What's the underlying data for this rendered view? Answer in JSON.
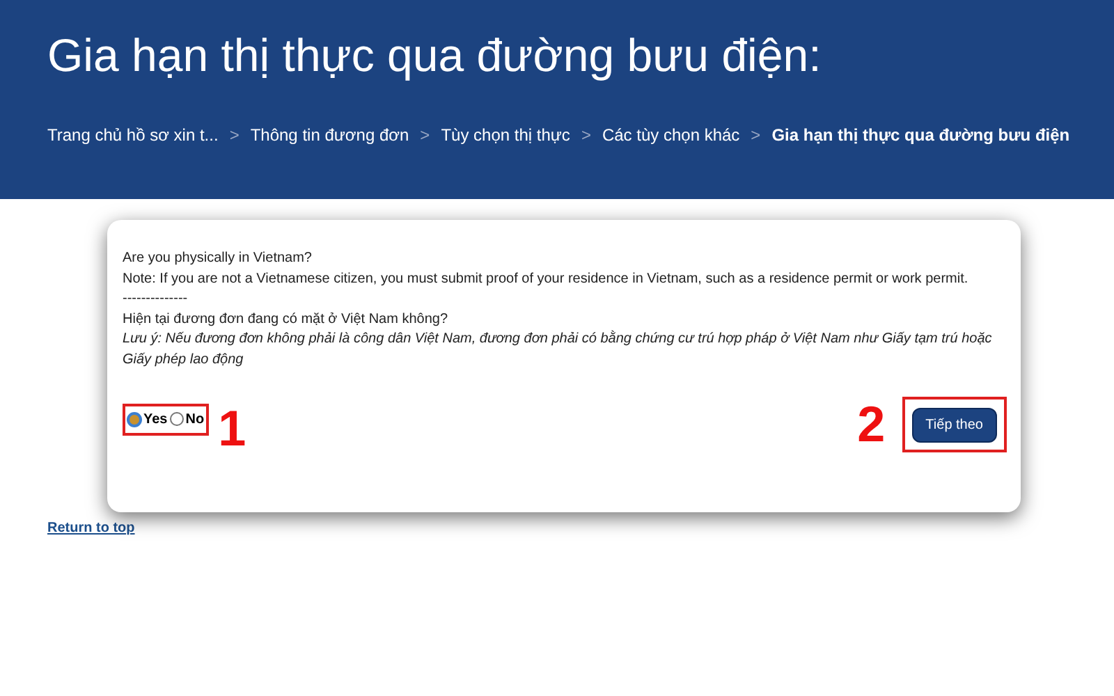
{
  "header": {
    "title": "Gia hạn thị thực qua đường bưu điện:"
  },
  "breadcrumbs": [
    {
      "label": "Trang chủ hồ sơ xin t...",
      "current": false
    },
    {
      "label": "Thông tin đương đơn",
      "current": false
    },
    {
      "label": "Tùy chọn thị thực",
      "current": false
    },
    {
      "label": "Các tùy chọn khác",
      "current": false
    },
    {
      "label": "Gia hạn thị thực qua đường bưu điện",
      "current": true
    }
  ],
  "breadcrumb_separator": ">",
  "question": {
    "lines": [
      {
        "kind": "plain",
        "text": "Are you physically in Vietnam?"
      },
      {
        "kind": "plain",
        "text": "Note: If you are not a Vietnamese citizen, you must submit proof of your residence in Vietnam, such as a residence permit or work permit."
      },
      {
        "kind": "plain",
        "text": "--------------"
      },
      {
        "kind": "plain",
        "text": "Hiện tại đương đơn đang có mặt ở Việt Nam không?"
      },
      {
        "kind": "italic",
        "text": "Lưu ý: Nếu đương đơn không phải là công dân Việt Nam, đương đơn phải có bằng chứng cư trú hợp pháp ở Việt Nam như Giấy tạm trú hoặc Giấy phép lao động"
      }
    ],
    "options": [
      {
        "label": "Yes",
        "selected": true
      },
      {
        "label": "No",
        "selected": false
      }
    ]
  },
  "annotations": [
    "1",
    "2"
  ],
  "next_button": "Tiếp theo",
  "return_link": "Return to top"
}
